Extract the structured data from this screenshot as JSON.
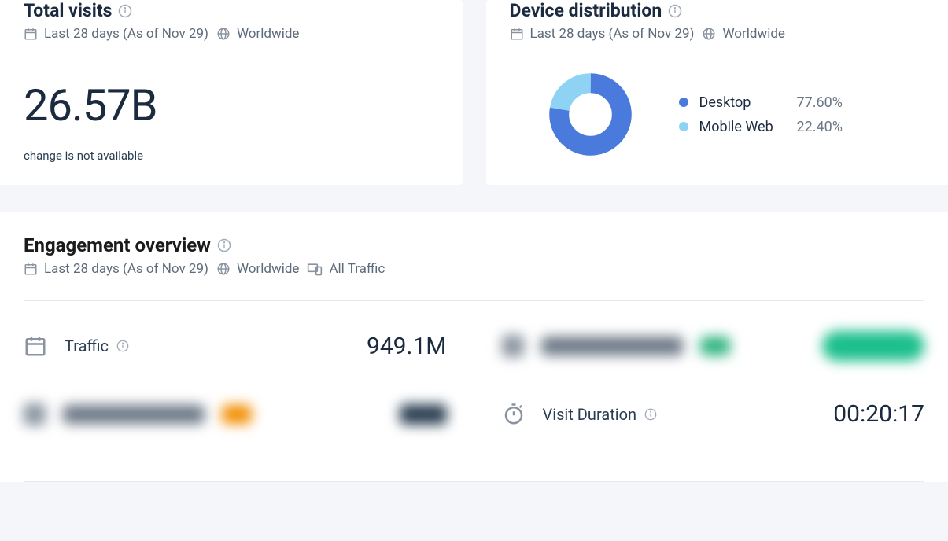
{
  "total_visits": {
    "title": "Total visits",
    "date_range": "Last 28 days (As of Nov 29)",
    "region": "Worldwide",
    "value": "26.57B",
    "change_note": "change is not available"
  },
  "device_distribution": {
    "title": "Device distribution",
    "date_range": "Last 28 days (As of Nov 29)",
    "region": "Worldwide",
    "items": [
      {
        "label": "Desktop",
        "value": "77.60%",
        "color": "#4a7bdc"
      },
      {
        "label": "Mobile Web",
        "value": "22.40%",
        "color": "#8fd3f4"
      }
    ]
  },
  "engagement": {
    "title": "Engagement overview",
    "date_range": "Last 28 days (As of Nov 29)",
    "region": "Worldwide",
    "traffic_filter": "All Traffic",
    "metrics": {
      "traffic": {
        "label": "Traffic",
        "value": "949.1M"
      },
      "visit_duration": {
        "label": "Visit Duration",
        "value": "00:20:17"
      }
    }
  },
  "chart_data": {
    "type": "pie",
    "title": "Device distribution",
    "series": [
      {
        "name": "Desktop",
        "value": 77.6,
        "color": "#4a7bdc"
      },
      {
        "name": "Mobile Web",
        "value": 22.4,
        "color": "#8fd3f4"
      }
    ]
  }
}
